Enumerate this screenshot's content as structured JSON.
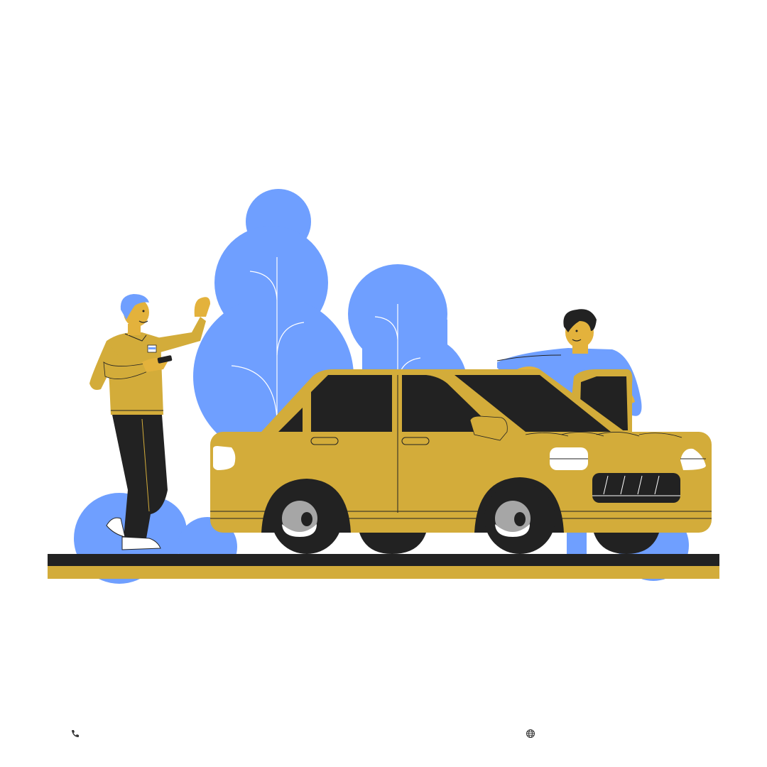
{
  "colors": {
    "blue": "#6f9fff",
    "mustard": "#d3ac3a",
    "dark": "#222222",
    "skin": "#e3b23c",
    "white": "#ffffff",
    "hubcap": "#a6a6a6"
  },
  "footer": {
    "phone_icon": "phone-icon",
    "phone_text": "",
    "web_icon": "globe-icon",
    "web_text": ""
  }
}
